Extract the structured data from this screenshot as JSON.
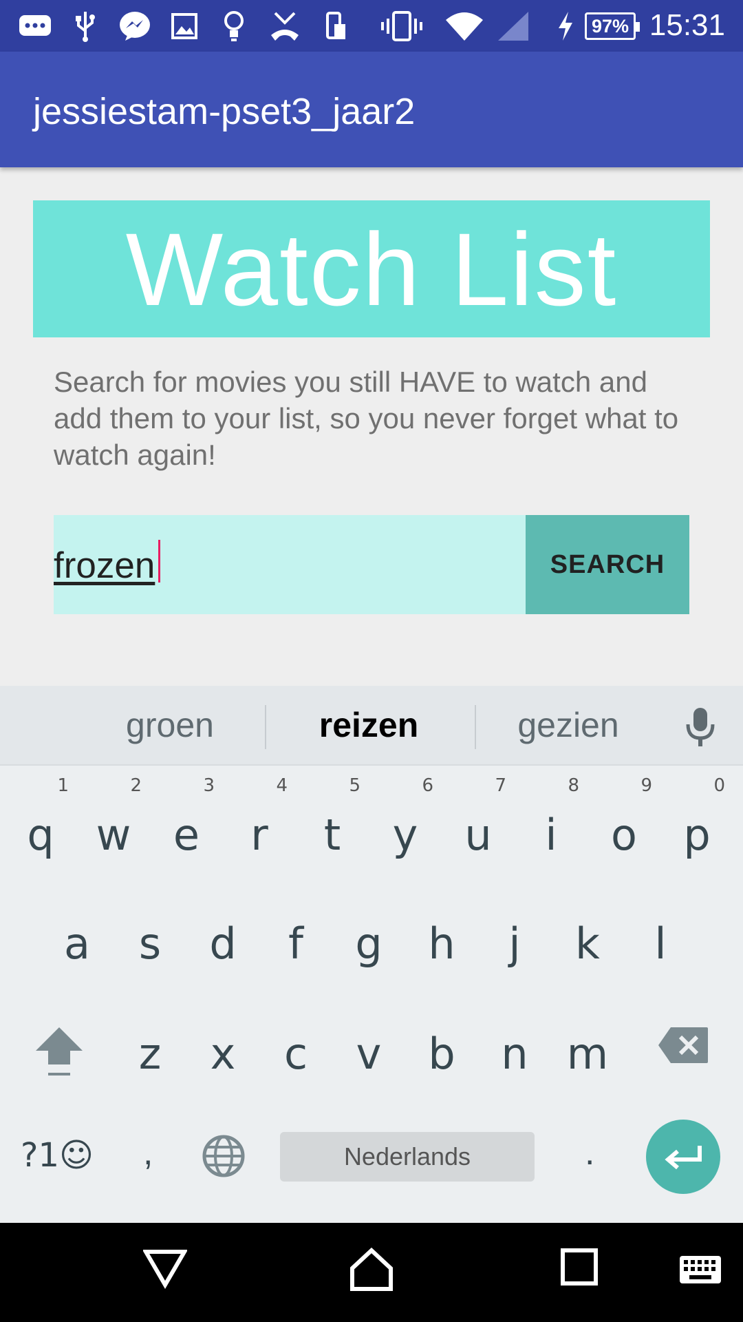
{
  "status_bar": {
    "time": "15:31",
    "battery": "97%",
    "icons": [
      "chat-notification-icon",
      "usb-icon",
      "messenger-icon",
      "image-icon",
      "bulb-icon",
      "missed-call-icon",
      "phone-storage-icon",
      "vibrate-icon",
      "wifi-icon",
      "cell-signal-icon",
      "charging-icon"
    ]
  },
  "app_bar": {
    "title": "jessiestam-pset3_jaar2"
  },
  "main": {
    "banner_title": "Watch List",
    "description": "Search for movies you still HAVE to watch and add them to your list, so you never forget what to watch again!",
    "search": {
      "value": "frozen",
      "button_label": "SEARCH"
    }
  },
  "keyboard": {
    "suggestions": [
      "groen",
      "reizen",
      "gezien"
    ],
    "row1": [
      {
        "key": "q",
        "hint": "1"
      },
      {
        "key": "w",
        "hint": "2"
      },
      {
        "key": "e",
        "hint": "3"
      },
      {
        "key": "r",
        "hint": "4"
      },
      {
        "key": "t",
        "hint": "5"
      },
      {
        "key": "y",
        "hint": "6"
      },
      {
        "key": "u",
        "hint": "7"
      },
      {
        "key": "i",
        "hint": "8"
      },
      {
        "key": "o",
        "hint": "9"
      },
      {
        "key": "p",
        "hint": "0"
      }
    ],
    "row2": [
      "a",
      "s",
      "d",
      "f",
      "g",
      "h",
      "j",
      "k",
      "l"
    ],
    "row3": [
      "z",
      "x",
      "c",
      "v",
      "b",
      "n",
      "m"
    ],
    "symbols_label": "?1☺",
    "comma": ",",
    "period": ".",
    "space_label": "Nederlands"
  },
  "colors": {
    "status_bar": "#303f9f",
    "app_bar": "#3f51b5",
    "banner": "#6fe3d9",
    "search_field": "#c4f3ef",
    "search_button": "#5dbab1",
    "enter_key": "#4db6ac",
    "caret": "#e91e63"
  }
}
